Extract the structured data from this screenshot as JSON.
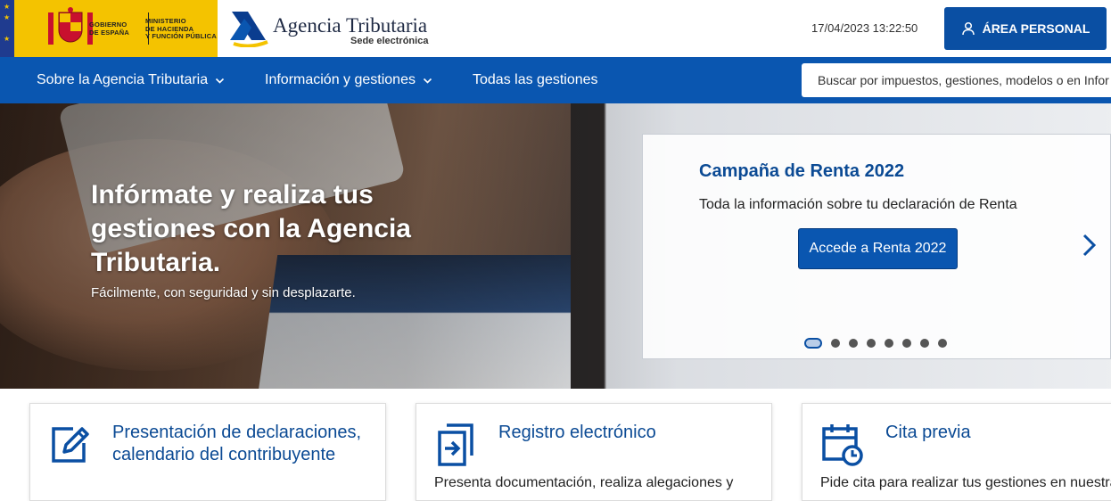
{
  "header": {
    "gov_line1": [
      "GOBIERNO",
      "DE ESPAÑA"
    ],
    "gov_line2": [
      "MINISTERIO",
      "DE HACIENDA",
      "Y FUNCIÓN PÚBLICA"
    ],
    "agency_name": "Agencia Tributaria",
    "agency_sub": "Sede electrónica",
    "datetime": "17/04/2023 13:22:50",
    "area_personal_label": "ÁREA PERSONAL"
  },
  "nav": {
    "items": [
      {
        "label": "Sobre la Agencia Tributaria",
        "has_dropdown": true
      },
      {
        "label": "Información y gestiones",
        "has_dropdown": true
      },
      {
        "label": "Todas las gestiones",
        "has_dropdown": false
      }
    ],
    "search_placeholder": "Buscar por impuestos, gestiones, modelos o en Infor..."
  },
  "hero": {
    "title": "Infórmate y realiza tus gestiones con la Agencia Tributaria.",
    "subtitle": "Fácilmente, con seguridad y sin desplazarte.",
    "card": {
      "title": "Campaña de Renta 2022",
      "text": "Toda la información sobre tu declaración de Renta",
      "button_label": "Accede a Renta 2022",
      "slide_count": 8,
      "active_slide": 1
    }
  },
  "tiles": [
    {
      "title": "Presentación de declaraciones, calendario del contribuyente",
      "description": "",
      "icon": "edit-icon"
    },
    {
      "title": "Registro electrónico",
      "description": "Presenta documentación, realiza alegaciones y",
      "icon": "register-icon"
    },
    {
      "title": "Cita previa",
      "description": "Pide cita para realizar tus gestiones en nuestras",
      "icon": "calendar-clock-icon"
    }
  ],
  "colors": {
    "primary": "#0a56b0",
    "dark_primary": "#0a4fa3",
    "title_blue": "#0b4a94",
    "gov_yellow": "#f4c300"
  }
}
